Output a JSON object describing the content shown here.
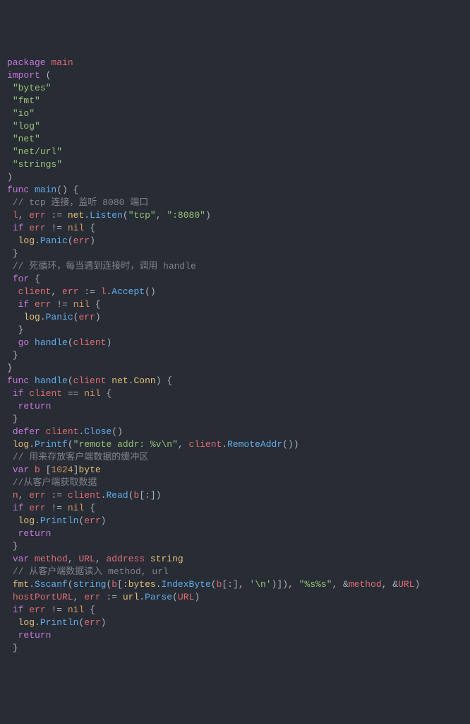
{
  "code": {
    "tokens": [
      [
        [
          "kw",
          "package"
        ],
        [
          "plain",
          " "
        ],
        [
          "id",
          "main"
        ]
      ],
      [
        [
          "kw",
          "import"
        ],
        [
          "plain",
          " ("
        ]
      ],
      [
        [
          "plain",
          " "
        ],
        [
          "str",
          "\"bytes\""
        ]
      ],
      [
        [
          "plain",
          " "
        ],
        [
          "str",
          "\"fmt\""
        ]
      ],
      [
        [
          "plain",
          " "
        ],
        [
          "str",
          "\"io\""
        ]
      ],
      [
        [
          "plain",
          " "
        ],
        [
          "str",
          "\"log\""
        ]
      ],
      [
        [
          "plain",
          " "
        ],
        [
          "str",
          "\"net\""
        ]
      ],
      [
        [
          "plain",
          " "
        ],
        [
          "str",
          "\"net/url\""
        ]
      ],
      [
        [
          "plain",
          " "
        ],
        [
          "str",
          "\"strings\""
        ]
      ],
      [
        [
          "plain",
          ")"
        ]
      ],
      [
        [
          "kw",
          "func"
        ],
        [
          "plain",
          " "
        ],
        [
          "fn",
          "main"
        ],
        [
          "plain",
          "() {"
        ]
      ],
      [
        [
          "plain",
          " "
        ],
        [
          "cmt",
          "// tcp 连接，监听 8080 端口"
        ]
      ],
      [
        [
          "plain",
          " "
        ],
        [
          "id",
          "l"
        ],
        [
          "plain",
          ", "
        ],
        [
          "id",
          "err"
        ],
        [
          "plain",
          " := "
        ],
        [
          "pkg",
          "net"
        ],
        [
          "plain",
          "."
        ],
        [
          "fn",
          "Listen"
        ],
        [
          "plain",
          "("
        ],
        [
          "str",
          "\"tcp\""
        ],
        [
          "plain",
          ", "
        ],
        [
          "str",
          "\":8080\""
        ],
        [
          "plain",
          ")"
        ]
      ],
      [
        [
          "plain",
          " "
        ],
        [
          "kw",
          "if"
        ],
        [
          "plain",
          " "
        ],
        [
          "id",
          "err"
        ],
        [
          "plain",
          " != "
        ],
        [
          "num",
          "nil"
        ],
        [
          "plain",
          " {"
        ]
      ],
      [
        [
          "plain",
          "  "
        ],
        [
          "pkg",
          "log"
        ],
        [
          "plain",
          "."
        ],
        [
          "fn",
          "Panic"
        ],
        [
          "plain",
          "("
        ],
        [
          "id",
          "err"
        ],
        [
          "plain",
          ")"
        ]
      ],
      [
        [
          "plain",
          " }"
        ]
      ],
      [
        [
          "plain",
          " "
        ],
        [
          "cmt",
          "// 死循环，每当遇到连接时，调用 handle"
        ]
      ],
      [
        [
          "plain",
          " "
        ],
        [
          "kw",
          "for"
        ],
        [
          "plain",
          " {"
        ]
      ],
      [
        [
          "plain",
          "  "
        ],
        [
          "id",
          "client"
        ],
        [
          "plain",
          ", "
        ],
        [
          "id",
          "err"
        ],
        [
          "plain",
          " := "
        ],
        [
          "id",
          "l"
        ],
        [
          "plain",
          "."
        ],
        [
          "fn",
          "Accept"
        ],
        [
          "plain",
          "()"
        ]
      ],
      [
        [
          "plain",
          "  "
        ],
        [
          "kw",
          "if"
        ],
        [
          "plain",
          " "
        ],
        [
          "id",
          "err"
        ],
        [
          "plain",
          " != "
        ],
        [
          "num",
          "nil"
        ],
        [
          "plain",
          " {"
        ]
      ],
      [
        [
          "plain",
          "   "
        ],
        [
          "pkg",
          "log"
        ],
        [
          "plain",
          "."
        ],
        [
          "fn",
          "Panic"
        ],
        [
          "plain",
          "("
        ],
        [
          "id",
          "err"
        ],
        [
          "plain",
          ")"
        ]
      ],
      [
        [
          "plain",
          "  }"
        ]
      ],
      [
        [
          "plain",
          "  "
        ],
        [
          "kw",
          "go"
        ],
        [
          "plain",
          " "
        ],
        [
          "fn",
          "handle"
        ],
        [
          "plain",
          "("
        ],
        [
          "id",
          "client"
        ],
        [
          "plain",
          ")"
        ]
      ],
      [
        [
          "plain",
          " }"
        ]
      ],
      [
        [
          "plain",
          "}"
        ]
      ],
      [
        [
          "kw",
          "func"
        ],
        [
          "plain",
          " "
        ],
        [
          "fn",
          "handle"
        ],
        [
          "plain",
          "("
        ],
        [
          "id",
          "client"
        ],
        [
          "plain",
          " "
        ],
        [
          "pkg",
          "net"
        ],
        [
          "plain",
          "."
        ],
        [
          "ty",
          "Conn"
        ],
        [
          "plain",
          ") {"
        ]
      ],
      [
        [
          "plain",
          " "
        ],
        [
          "kw",
          "if"
        ],
        [
          "plain",
          " "
        ],
        [
          "id",
          "client"
        ],
        [
          "plain",
          " == "
        ],
        [
          "num",
          "nil"
        ],
        [
          "plain",
          " {"
        ]
      ],
      [
        [
          "plain",
          "  "
        ],
        [
          "kw",
          "return"
        ]
      ],
      [
        [
          "plain",
          " }"
        ]
      ],
      [
        [
          "plain",
          " "
        ],
        [
          "kw",
          "defer"
        ],
        [
          "plain",
          " "
        ],
        [
          "id",
          "client"
        ],
        [
          "plain",
          "."
        ],
        [
          "fn",
          "Close"
        ],
        [
          "plain",
          "()"
        ]
      ],
      [
        [
          "plain",
          " "
        ],
        [
          "pkg",
          "log"
        ],
        [
          "plain",
          "."
        ],
        [
          "fn",
          "Printf"
        ],
        [
          "plain",
          "("
        ],
        [
          "str",
          "\"remote addr: %v\\n\""
        ],
        [
          "plain",
          ", "
        ],
        [
          "id",
          "client"
        ],
        [
          "plain",
          "."
        ],
        [
          "fn",
          "RemoteAddr"
        ],
        [
          "plain",
          "())"
        ]
      ],
      [
        [
          "plain",
          " "
        ],
        [
          "cmt",
          "// 用来存放客户端数据的缓冲区"
        ]
      ],
      [
        [
          "plain",
          " "
        ],
        [
          "kw",
          "var"
        ],
        [
          "plain",
          " "
        ],
        [
          "id",
          "b"
        ],
        [
          "plain",
          " ["
        ],
        [
          "num",
          "1024"
        ],
        [
          "plain",
          "]"
        ],
        [
          "ty",
          "byte"
        ]
      ],
      [
        [
          "plain",
          " "
        ],
        [
          "cmt",
          "//从客户端获取数据"
        ]
      ],
      [
        [
          "plain",
          " "
        ],
        [
          "id",
          "n"
        ],
        [
          "plain",
          ", "
        ],
        [
          "id",
          "err"
        ],
        [
          "plain",
          " := "
        ],
        [
          "id",
          "client"
        ],
        [
          "plain",
          "."
        ],
        [
          "fn",
          "Read"
        ],
        [
          "plain",
          "("
        ],
        [
          "id",
          "b"
        ],
        [
          "plain",
          "[:])"
        ]
      ],
      [
        [
          "plain",
          " "
        ],
        [
          "kw",
          "if"
        ],
        [
          "plain",
          " "
        ],
        [
          "id",
          "err"
        ],
        [
          "plain",
          " != "
        ],
        [
          "num",
          "nil"
        ],
        [
          "plain",
          " {"
        ]
      ],
      [
        [
          "plain",
          "  "
        ],
        [
          "pkg",
          "log"
        ],
        [
          "plain",
          "."
        ],
        [
          "fn",
          "Println"
        ],
        [
          "plain",
          "("
        ],
        [
          "id",
          "err"
        ],
        [
          "plain",
          ")"
        ]
      ],
      [
        [
          "plain",
          "  "
        ],
        [
          "kw",
          "return"
        ]
      ],
      [
        [
          "plain",
          " }"
        ]
      ],
      [
        [
          "plain",
          " "
        ],
        [
          "kw",
          "var"
        ],
        [
          "plain",
          " "
        ],
        [
          "id",
          "method"
        ],
        [
          "plain",
          ", "
        ],
        [
          "id",
          "URL"
        ],
        [
          "plain",
          ", "
        ],
        [
          "id",
          "address"
        ],
        [
          "plain",
          " "
        ],
        [
          "ty",
          "string"
        ]
      ],
      [
        [
          "plain",
          " "
        ],
        [
          "cmt",
          "// 从客户端数据读入 method, url"
        ]
      ],
      [
        [
          "plain",
          " "
        ],
        [
          "pkg",
          "fmt"
        ],
        [
          "plain",
          "."
        ],
        [
          "fn",
          "Sscanf"
        ],
        [
          "plain",
          "("
        ],
        [
          "fn",
          "string"
        ],
        [
          "plain",
          "("
        ],
        [
          "id",
          "b"
        ],
        [
          "plain",
          "[:"
        ],
        [
          "pkg",
          "bytes"
        ],
        [
          "plain",
          "."
        ],
        [
          "fn",
          "IndexByte"
        ],
        [
          "plain",
          "("
        ],
        [
          "id",
          "b"
        ],
        [
          "plain",
          "[:], "
        ],
        [
          "str",
          "'\\n'"
        ],
        [
          "plain",
          ")]), "
        ],
        [
          "str",
          "\"%s%s\""
        ],
        [
          "plain",
          ", &"
        ],
        [
          "id",
          "method"
        ],
        [
          "plain",
          ", &"
        ],
        [
          "id",
          "URL"
        ],
        [
          "plain",
          ")"
        ]
      ],
      [
        [
          "plain",
          " "
        ],
        [
          "id",
          "hostPortURL"
        ],
        [
          "plain",
          ", "
        ],
        [
          "id",
          "err"
        ],
        [
          "plain",
          " := "
        ],
        [
          "pkg",
          "url"
        ],
        [
          "plain",
          "."
        ],
        [
          "fn",
          "Parse"
        ],
        [
          "plain",
          "("
        ],
        [
          "id",
          "URL"
        ],
        [
          "plain",
          ")"
        ]
      ],
      [
        [
          "plain",
          " "
        ],
        [
          "kw",
          "if"
        ],
        [
          "plain",
          " "
        ],
        [
          "id",
          "err"
        ],
        [
          "plain",
          " != "
        ],
        [
          "num",
          "nil"
        ],
        [
          "plain",
          " {"
        ]
      ],
      [
        [
          "plain",
          "  "
        ],
        [
          "pkg",
          "log"
        ],
        [
          "plain",
          "."
        ],
        [
          "fn",
          "Println"
        ],
        [
          "plain",
          "("
        ],
        [
          "id",
          "err"
        ],
        [
          "plain",
          ")"
        ]
      ],
      [
        [
          "plain",
          "  "
        ],
        [
          "kw",
          "return"
        ]
      ],
      [
        [
          "plain",
          " }"
        ]
      ]
    ]
  }
}
